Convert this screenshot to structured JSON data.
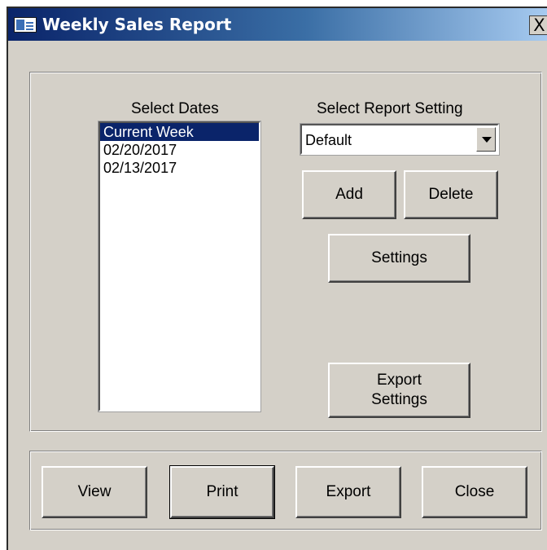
{
  "window": {
    "title": "Weekly Sales Report",
    "close_glyph": "X"
  },
  "dates": {
    "label": "Select Dates",
    "items": [
      "Current Week",
      "02/20/2017",
      "02/13/2017"
    ],
    "selected": "Current Week"
  },
  "report_setting": {
    "label": "Select Report Setting",
    "value": "Default",
    "add_label": "Add",
    "delete_label": "Delete",
    "settings_label": "Settings",
    "export_settings_label": "Export Settings",
    "export_settings_line1": "Export",
    "export_settings_line2": "Settings"
  },
  "actions": {
    "view_label": "View",
    "print_label": "Print",
    "export_label": "Export",
    "close_label": "Close"
  },
  "colors": {
    "selection": "#0a246a",
    "face": "#d4d0c8",
    "titlebar_start": "#0a246a",
    "titlebar_end": "#a6caf0"
  }
}
